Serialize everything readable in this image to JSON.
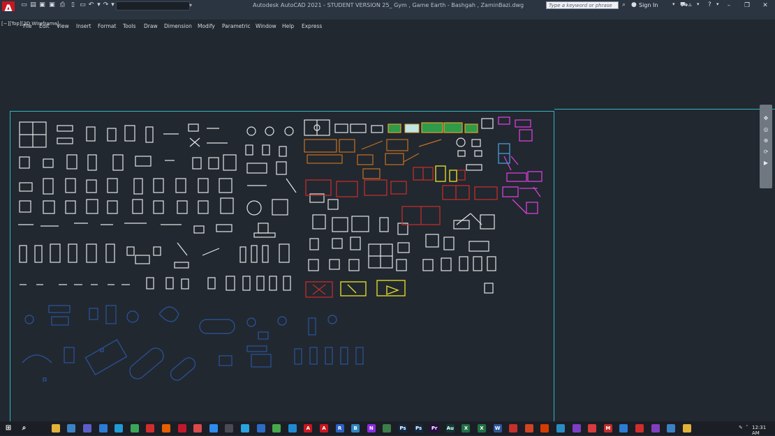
{
  "app": {
    "logo_letter": "A",
    "title": "Autodesk AutoCAD 2021 - STUDENT VERSION    25_ Gym , Game Earth - Bashgah , ZaminBazi.dwg",
    "workspace_value": "",
    "search_placeholder": "Type a keyword or phrase",
    "sign_in": "Sign In"
  },
  "menu": [
    "File",
    "Edit",
    "View",
    "Insert",
    "Format",
    "Tools",
    "Draw",
    "Dimension",
    "Modify",
    "Parametric",
    "Window",
    "Help",
    "Express"
  ],
  "viewport": {
    "label": "[−][Top][2D Wireframe]"
  },
  "nav_tools": [
    "pan-icon",
    "zoom-icon",
    "orbit-icon",
    "showmotion-icon",
    "steering-wheel-icon"
  ],
  "colors": {
    "background": "#212830",
    "title_bar": "#2b3441",
    "layout_frame": "#2fb7c4",
    "symbols_white": "#e8e8e8",
    "symbols_blue": "#2a4f8f",
    "symbols_red": "#c42b2b",
    "symbols_magenta": "#d93fd9",
    "symbols_yellow": "#e0d72a",
    "symbols_green": "#2f9a4a",
    "symbols_orange": "#c8701e",
    "logo_red": "#c8171f"
  },
  "taskbar": {
    "clock": "12:31 AM",
    "apps": [
      {
        "name": "start-icon",
        "label": "",
        "color": "#1c1e26"
      },
      {
        "name": "search-icon",
        "label": "",
        "color": "#1c1e26"
      },
      {
        "name": "store-icon",
        "label": "",
        "color": "#1c1e26"
      },
      {
        "name": "file-explorer-icon",
        "label": "",
        "color": "#e2b33b"
      },
      {
        "name": "weather-icon",
        "label": "",
        "color": "#3b82c4"
      },
      {
        "name": "teams-icon",
        "label": "",
        "color": "#5a5fc7"
      },
      {
        "name": "mail-icon",
        "label": "",
        "color": "#2b7cd3"
      },
      {
        "name": "edge-icon",
        "label": "",
        "color": "#1f9bd6"
      },
      {
        "name": "chrome-icon",
        "label": "",
        "color": "#3aa757"
      },
      {
        "name": "opera-icon",
        "label": "",
        "color": "#d12d2d"
      },
      {
        "name": "firefox-icon",
        "label": "",
        "color": "#e66000"
      },
      {
        "name": "opera-gx-icon",
        "label": "",
        "color": "#c4182a"
      },
      {
        "name": "browser-icon",
        "label": "",
        "color": "#d94a4a"
      },
      {
        "name": "app-icon",
        "label": "",
        "color": "#2d8cf0"
      },
      {
        "name": "settings-icon",
        "label": "",
        "color": "#4a4a55"
      },
      {
        "name": "telegram-icon",
        "label": "",
        "color": "#2aa3df"
      },
      {
        "name": "app2-icon",
        "label": "",
        "color": "#2b6cc4"
      },
      {
        "name": "app3-icon",
        "label": "",
        "color": "#47a84b"
      },
      {
        "name": "vscode-icon",
        "label": "",
        "color": "#1f8ad2"
      },
      {
        "name": "autocad-icon",
        "label": "A",
        "color": "#c8171f"
      },
      {
        "name": "autocad2-icon",
        "label": "A",
        "color": "#c8171f"
      },
      {
        "name": "revit-icon",
        "label": "R",
        "color": "#2a62c4"
      },
      {
        "name": "app4-icon",
        "label": "B",
        "color": "#2e86c1"
      },
      {
        "name": "app5-icon",
        "label": "N",
        "color": "#8a2be2"
      },
      {
        "name": "app6-icon",
        "label": "",
        "color": "#3c7d4a"
      },
      {
        "name": "photoshop-icon",
        "label": "Ps",
        "color": "#0e2a47"
      },
      {
        "name": "photoshop2-icon",
        "label": "Ps",
        "color": "#0e2a47"
      },
      {
        "name": "premiere-icon",
        "label": "Pr",
        "color": "#2a0b47"
      },
      {
        "name": "audition-icon",
        "label": "Au",
        "color": "#0b3b37"
      },
      {
        "name": "excel-icon",
        "label": "X",
        "color": "#1e7145"
      },
      {
        "name": "excel2-icon",
        "label": "X",
        "color": "#1e7145"
      },
      {
        "name": "word-icon",
        "label": "W",
        "color": "#2b579a"
      },
      {
        "name": "app7-icon",
        "label": "",
        "color": "#c4312b"
      },
      {
        "name": "app8-icon",
        "label": "",
        "color": "#d04423"
      },
      {
        "name": "app9-icon",
        "label": "",
        "color": "#d83b01"
      },
      {
        "name": "app10-icon",
        "label": "",
        "color": "#2a8cc4"
      },
      {
        "name": "app11-icon",
        "label": "",
        "color": "#7b3fc4"
      },
      {
        "name": "app12-icon",
        "label": "",
        "color": "#d83b3b"
      },
      {
        "name": "app13-icon",
        "label": "M",
        "color": "#c42b2b"
      },
      {
        "name": "app14-icon",
        "label": "",
        "color": "#2b7cd3"
      },
      {
        "name": "app15-icon",
        "label": "",
        "color": "#d12d2d"
      },
      {
        "name": "app16-icon",
        "label": "",
        "color": "#7f3fbf"
      },
      {
        "name": "app17-icon",
        "label": "",
        "color": "#3b82c4"
      },
      {
        "name": "app18-icon",
        "label": "",
        "color": "#e2b33b"
      }
    ]
  }
}
